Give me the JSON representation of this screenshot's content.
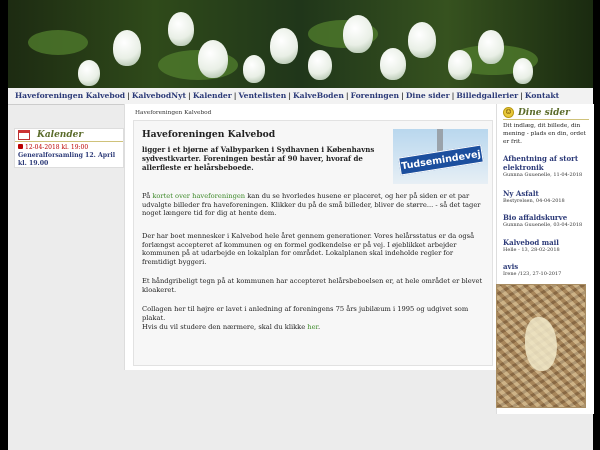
{
  "nav": {
    "items": [
      {
        "label": "Haveforeningen Kalvebod"
      },
      {
        "label": "KalvebodNyt"
      },
      {
        "label": "Kalender"
      },
      {
        "label": "Ventelisten"
      },
      {
        "label": "KalveBoden"
      },
      {
        "label": "Foreningen"
      },
      {
        "label": "Dine sider"
      },
      {
        "label": "Billedgallerier"
      },
      {
        "label": "Kontakt"
      }
    ],
    "separator": "|"
  },
  "calendar": {
    "title": "Kalender",
    "date": "12-04-2018 kl. 19:00",
    "event": "Generalforsamling 12. April kl. 19.00"
  },
  "main": {
    "breadcrumb": "Haveforeningen Kalvebod",
    "title": "Haveforeningen Kalvebod",
    "intro": "ligger i et bjørne af Valbyparken i Sydhavnen i Københavns sydvestkvarter. Foreningen består af 90 haver, hvoraf de allerfleste er helårsbeboede.",
    "p1_a": "På ",
    "p1_link": "kortet over haveforeningen",
    "p1_b": " kan du se hvorledes husene er placeret, og her på siden er et par udvalgte billeder fra haveforeningen. Klikker du på de små billeder, bliver de større... - så det tager noget længere tid for dig at hente dem.",
    "p2": "Der har boet mennesker i Kalvebod hele året gennem generationer. Vores helårsstatus er da også forlængst accepteret af kommunen og en formel godkendelse er på vej. I øjeblikket arbejder kommunen på at udarbejde en lokalplan for området. Lokalplanen skal indeholde regler for fremtidigt byggeri.",
    "p3": "Et håndgribeligt tegn på at kommunen har accepteret helårsbeboelsen er, at hele området er blevet kloakeret.",
    "p4": "Collagen her til højre er lavet i anledning af foreningens 75 års jubilæum i 1995 og udgivet som plakat.",
    "p5_a": "Hvis du vil studere den nærmere, skal du klikke ",
    "p5_link": "her",
    "p5_b": ".",
    "sign_text": "Tudsemindevej"
  },
  "right": {
    "title": "Dine sider",
    "intro": "Dit indlæg, dit billede, din mening - plads en din, ordet er frit.",
    "items": [
      {
        "title": "Afhentning af stort elektronik",
        "meta": "Gunnna Guuenelle, 11-04-2018"
      },
      {
        "title": "Ny Asfalt",
        "meta": "Bestyrelsen, 04-04-2018"
      },
      {
        "title": "Bio affaldskurve",
        "meta": "Gunnna Guuenelle, 03-04-2018"
      },
      {
        "title": "Kalvebod mail",
        "meta": "Helle - 13, 28-02-2018"
      },
      {
        "title": "avis",
        "meta": "Irene /123, 27-10-2017"
      }
    ]
  },
  "colors": {
    "nav_text": "#2c3a78",
    "link_green": "#3e8a2a",
    "calendar_red": "#b00000",
    "header_olive": "#5a6b2a"
  },
  "icons": [
    "calendar-icon",
    "smiley-icon",
    "flower-banner",
    "street-sign-image",
    "collage-image"
  ]
}
